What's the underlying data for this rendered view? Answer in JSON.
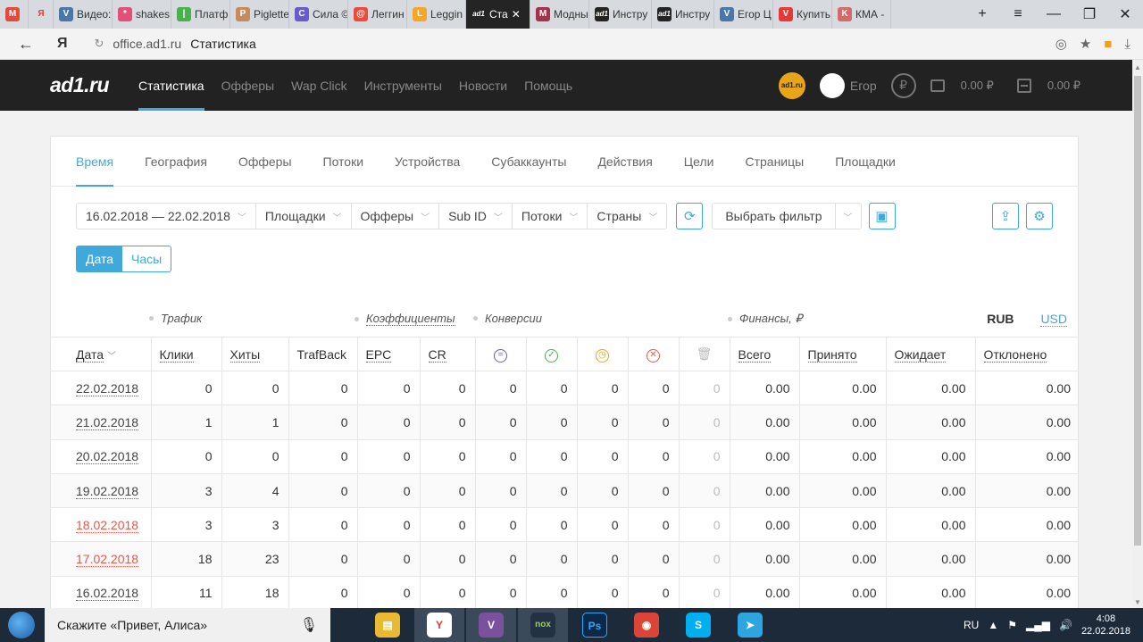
{
  "browser": {
    "tabs": [
      {
        "label": "",
        "color": "#e04a3f",
        "glyph": "M"
      },
      {
        "label": "",
        "color": "#d7dbe0",
        "glyph": "Я"
      },
      {
        "label": "Видео:",
        "color": "#4a76a8",
        "glyph": "V"
      },
      {
        "label": "shakes",
        "color": "#e2507a",
        "glyph": "*"
      },
      {
        "label": "Платф",
        "color": "#4caf50",
        "glyph": "|"
      },
      {
        "label": "Piglette",
        "color": "#c48b5e",
        "glyph": "P"
      },
      {
        "label": "Сила ©",
        "color": "#6a5acd",
        "glyph": "C"
      },
      {
        "label": "Леггин",
        "color": "#ec4b3c",
        "glyph": "@"
      },
      {
        "label": "Leggin",
        "color": "#f4a62a",
        "glyph": "L"
      },
      {
        "label": "Ста",
        "color": "#242424",
        "glyph": "ad1",
        "active": true
      },
      {
        "label": "Модны",
        "color": "#a3324b",
        "glyph": "M"
      },
      {
        "label": "Инстру",
        "color": "#242424",
        "glyph": "ad1"
      },
      {
        "label": "Инстру",
        "color": "#242424",
        "glyph": "ad1"
      },
      {
        "label": "Егор Ц",
        "color": "#4a76a8",
        "glyph": "V"
      },
      {
        "label": "Купить",
        "color": "#e53935",
        "glyph": "V"
      },
      {
        "label": "КМА -",
        "color": "#d46a6a",
        "glyph": "K"
      }
    ],
    "address": {
      "url": "office.ad1.ru",
      "page_title": "Статистика",
      "yandex_glyph": "Я"
    }
  },
  "header": {
    "logo": "ad1.ru",
    "nav": [
      "Статистика",
      "Офферы",
      "Wap Click",
      "Инструменты",
      "Новости",
      "Помощь"
    ],
    "badge_text": "ad1.ru",
    "user_name": "Егор",
    "ruble_symbol": "₽",
    "balance_1": "0.00 ₽",
    "balance_2": "0.00 ₽"
  },
  "subtabs": [
    "Время",
    "География",
    "Офферы",
    "Потоки",
    "Устройства",
    "Субаккаунты",
    "Действия",
    "Цели",
    "Страницы",
    "Площадки"
  ],
  "filters": {
    "date_range": "16.02.2018 — 22.02.2018",
    "items": [
      "Площадки",
      "Офферы",
      "Sub ID",
      "Потоки",
      "Страны"
    ],
    "choose_filter": "Выбрать фильтр"
  },
  "toggle": {
    "date": "Дата",
    "hours": "Часы"
  },
  "groups": {
    "traffic": "Трафик",
    "coefficients": "Коэффициенты",
    "conversions": "Конверсии",
    "finances": "Финансы, ₽",
    "rub": "RUB",
    "usd": "USD"
  },
  "table": {
    "headers": {
      "date": "Дата",
      "clicks": "Клики",
      "hits": "Хиты",
      "trafback": "TrafBack",
      "epc": "EPC",
      "cr": "CR",
      "total": "Всего",
      "accepted": "Принято",
      "pending": "Ожидает",
      "rejected": "Отклонено"
    },
    "rows": [
      {
        "date": "22.02.2018",
        "weekend": false,
        "v": [
          "0",
          "0",
          "0",
          "0",
          "0",
          "0",
          "0",
          "0",
          "0",
          "0",
          "0.00",
          "0.00",
          "0.00",
          "0.00"
        ]
      },
      {
        "date": "21.02.2018",
        "weekend": false,
        "v": [
          "1",
          "1",
          "0",
          "0",
          "0",
          "0",
          "0",
          "0",
          "0",
          "0",
          "0.00",
          "0.00",
          "0.00",
          "0.00"
        ]
      },
      {
        "date": "20.02.2018",
        "weekend": false,
        "v": [
          "0",
          "0",
          "0",
          "0",
          "0",
          "0",
          "0",
          "0",
          "0",
          "0",
          "0.00",
          "0.00",
          "0.00",
          "0.00"
        ]
      },
      {
        "date": "19.02.2018",
        "weekend": false,
        "v": [
          "3",
          "4",
          "0",
          "0",
          "0",
          "0",
          "0",
          "0",
          "0",
          "0",
          "0.00",
          "0.00",
          "0.00",
          "0.00"
        ]
      },
      {
        "date": "18.02.2018",
        "weekend": true,
        "v": [
          "3",
          "3",
          "0",
          "0",
          "0",
          "0",
          "0",
          "0",
          "0",
          "0",
          "0.00",
          "0.00",
          "0.00",
          "0.00"
        ]
      },
      {
        "date": "17.02.2018",
        "weekend": true,
        "v": [
          "18",
          "23",
          "0",
          "0",
          "0",
          "0",
          "0",
          "0",
          "0",
          "0",
          "0.00",
          "0.00",
          "0.00",
          "0.00"
        ]
      },
      {
        "date": "16.02.2018",
        "weekend": false,
        "v": [
          "11",
          "18",
          "0",
          "0",
          "0",
          "0",
          "0",
          "0",
          "0",
          "0",
          "0.00",
          "0.00",
          "0.00",
          "0.00"
        ]
      }
    ]
  },
  "taskbar": {
    "search_text": "Скажите «Привет, Алиса»",
    "apps": [
      {
        "name": "explorer",
        "color": "#e8b931",
        "glyph": "▤"
      },
      {
        "name": "yandex-browser",
        "color": "#ffffff",
        "glyph": "Y"
      },
      {
        "name": "viber",
        "color": "#7b519d",
        "glyph": "V"
      },
      {
        "name": "nox",
        "color": "#233142",
        "glyph": "nox"
      },
      {
        "name": "photoshop",
        "color": "#0b2a4a",
        "glyph": "Ps"
      },
      {
        "name": "chrome",
        "color": "#db4437",
        "glyph": "◉"
      },
      {
        "name": "skype",
        "color": "#00aff0",
        "glyph": "S"
      },
      {
        "name": "telegram",
        "color": "#2ca5e0",
        "glyph": "➤"
      }
    ],
    "lang": "RU",
    "time": "4:08",
    "date": "22.02.2018"
  }
}
